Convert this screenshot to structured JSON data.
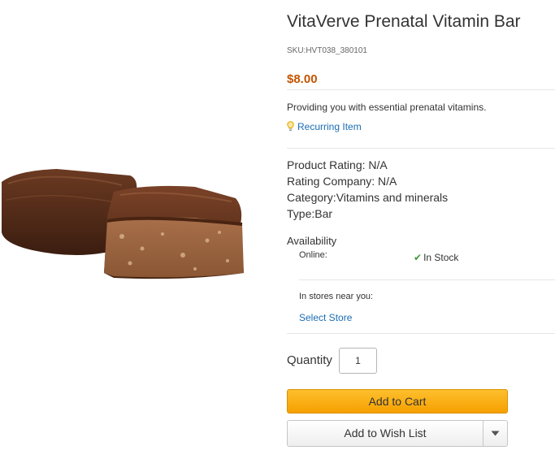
{
  "product": {
    "title": "VitaVerve Prenatal Vitamin Bar",
    "sku": "SKU:HVT038_380101",
    "price": "$8.00",
    "description": "Providing you with essential prenatal vitamins.",
    "recurring_label": "Recurring Item",
    "image_icon": "chocolate-bar-photo"
  },
  "specs": {
    "rating": "Product Rating: N/A",
    "rating_company": "Rating Company: N/A",
    "category": "Category:Vitamins and minerals",
    "type": "Type:Bar"
  },
  "availability": {
    "title": "Availability",
    "online_label": "Online:",
    "online_status": "In Stock",
    "stores_label": "In stores near you:",
    "select_store": "Select Store"
  },
  "purchase": {
    "quantity_label": "Quantity",
    "quantity_value": "1",
    "add_to_cart": "Add to Cart",
    "add_to_wish_list": "Add to Wish List"
  },
  "colors": {
    "price": "#c45500",
    "link": "#1a6db3",
    "cart_button": "#f6a000",
    "in_stock_check": "#3c9a3c"
  }
}
